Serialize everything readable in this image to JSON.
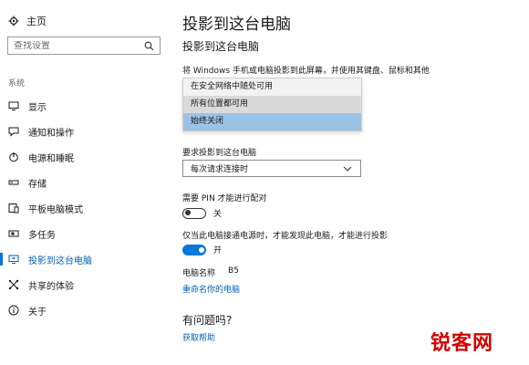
{
  "sidebar": {
    "home_label": "主页",
    "search_placeholder": "查找设置",
    "section_label": "系统",
    "items": [
      {
        "label": "显示",
        "icon": "monitor-icon"
      },
      {
        "label": "通知和操作",
        "icon": "message-icon"
      },
      {
        "label": "电源和睡眠",
        "icon": "power-icon"
      },
      {
        "label": "存储",
        "icon": "storage-icon"
      },
      {
        "label": "平板电脑模式",
        "icon": "tablet-icon"
      },
      {
        "label": "多任务",
        "icon": "multitask-icon"
      },
      {
        "label": "投影到这台电脑",
        "icon": "project-icon",
        "active": true
      },
      {
        "label": "共享的体验",
        "icon": "share-icon"
      },
      {
        "label": "关于",
        "icon": "info-icon"
      }
    ]
  },
  "main": {
    "title": "投影到这台电脑",
    "subtitle": "投影到这台电脑",
    "description": "将 Windows 手机或电脑投影到此屏幕，并使用其键盘、鼠标和其他",
    "availability_options": [
      "在安全网络中随处可用",
      "所有位置都可用",
      "始终关闭"
    ],
    "availability_selected": "始终关闭",
    "request_label": "要求投影到这台电脑",
    "request_value": "每次请求连接时",
    "pin_label": "需要 PIN 才能进行配对",
    "pin_state": "关",
    "power_label": "仅当此电脑接通电源时，才能发现此电脑，才能进行投影",
    "power_state": "开",
    "pc_name_label": "电脑名称",
    "pc_name_value": "B5",
    "rename_link": "重命名你的电脑",
    "question": "有问题吗?",
    "help_link": "获取帮助"
  },
  "watermark": "锐客网",
  "colors": {
    "accent": "#0078d7",
    "link": "#0063b1",
    "selected_option": "#9cc3e6",
    "watermark": "#d40000"
  }
}
